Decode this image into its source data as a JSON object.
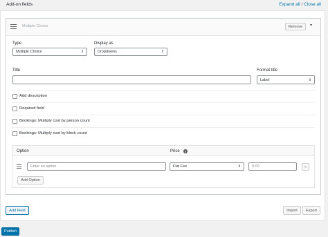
{
  "header": {
    "title": "Add-on fields",
    "expand_all": "Expand all",
    "separator": "/",
    "close_all": "Close all"
  },
  "addon": {
    "name_placeholder": "Multiple Choice",
    "remove_label": "Remove",
    "type_label": "Type",
    "type_value": "Multiple Choice",
    "display_label": "Display as",
    "display_value": "Dropdowns",
    "title_label": "Title",
    "title_value": "",
    "format_title_label": "Format title",
    "format_title_value": "Label",
    "checkboxes": [
      {
        "label": "Add description",
        "checked": false
      },
      {
        "label": "Required field",
        "checked": false
      },
      {
        "label": "Bookings: Multiply cost by person count",
        "checked": false
      },
      {
        "label": "Bookings: Multiply cost by block count",
        "checked": false
      }
    ]
  },
  "options": {
    "col_option": "Option",
    "col_price": "Price",
    "rows": [
      {
        "placeholder": "Enter an option",
        "price_type": "Flat Fee",
        "price_placeholder": "0.00",
        "remove": "x"
      }
    ],
    "add_option_label": "Add Option"
  },
  "footer": {
    "add_field_label": "Add Field",
    "import_label": "Import",
    "export_label": "Export",
    "publish_label": "Publish"
  }
}
